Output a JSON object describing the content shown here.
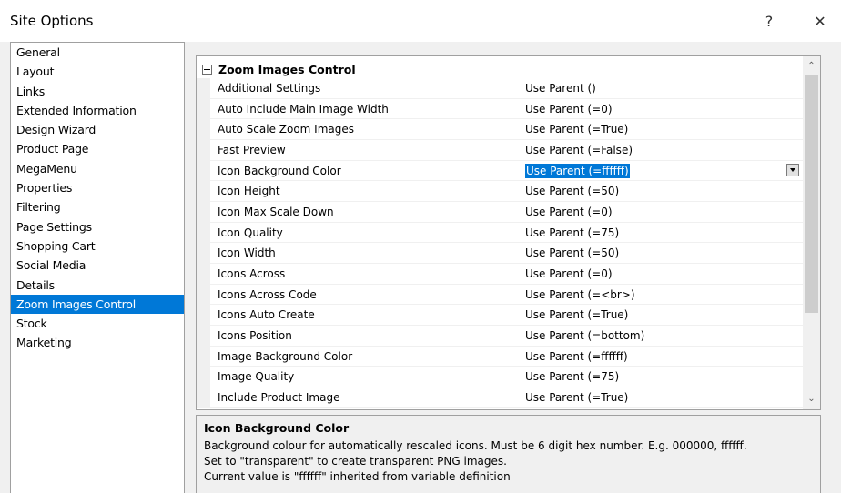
{
  "window": {
    "title": "Site Options",
    "help_label": "?",
    "close_label": "✕"
  },
  "sidebar": {
    "items": [
      {
        "label": "General"
      },
      {
        "label": "Layout"
      },
      {
        "label": "Links"
      },
      {
        "label": "Extended Information"
      },
      {
        "label": "Design Wizard"
      },
      {
        "label": "Product Page"
      },
      {
        "label": "MegaMenu"
      },
      {
        "label": "Properties"
      },
      {
        "label": "Filtering"
      },
      {
        "label": "Page Settings"
      },
      {
        "label": "Shopping Cart"
      },
      {
        "label": "Social Media"
      },
      {
        "label": "Details"
      },
      {
        "label": "Zoom Images Control"
      },
      {
        "label": "Stock"
      },
      {
        "label": "Marketing"
      }
    ],
    "selected_index": 13
  },
  "grid": {
    "category": "Zoom Images Control",
    "rows": [
      {
        "name": "Additional Settings",
        "value": "Use Parent ()"
      },
      {
        "name": "Auto Include Main Image Width",
        "value": "Use Parent (=0)"
      },
      {
        "name": "Auto Scale Zoom Images",
        "value": "Use Parent (=True)"
      },
      {
        "name": "Fast Preview",
        "value": "Use Parent (=False)"
      },
      {
        "name": "Icon Background Color",
        "value": "Use Parent (=ffffff)"
      },
      {
        "name": "Icon Height",
        "value": "Use Parent (=50)"
      },
      {
        "name": "Icon Max Scale Down",
        "value": "Use Parent (=0)"
      },
      {
        "name": "Icon Quality",
        "value": "Use Parent (=75)"
      },
      {
        "name": "Icon Width",
        "value": "Use Parent (=50)"
      },
      {
        "name": "Icons Across",
        "value": "Use Parent (=0)"
      },
      {
        "name": "Icons Across Code",
        "value": "Use Parent (=<br>)"
      },
      {
        "name": "Icons Auto Create",
        "value": "Use Parent (=True)"
      },
      {
        "name": "Icons Position",
        "value": "Use Parent (=bottom)"
      },
      {
        "name": "Image Background Color",
        "value": "Use Parent (=ffffff)"
      },
      {
        "name": "Image Quality",
        "value": "Use Parent (=75)"
      },
      {
        "name": "Include Product Image",
        "value": "Use Parent (=True)"
      }
    ],
    "selected_row": 4,
    "scroll_up_glyph": "⌃",
    "scroll_down_glyph": "⌄"
  },
  "description": {
    "title": "Icon Background Color",
    "lines": [
      "Background colour for automatically rescaled icons.  Must be 6 digit hex number.  E.g. 000000, ffffff.",
      "Set to \"transparent\" to create transparent PNG images.",
      "Current value is \"ffffff\" inherited from variable definition"
    ]
  },
  "colors": {
    "selection": "#0078d7",
    "window_bg": "#f0f0f0"
  }
}
